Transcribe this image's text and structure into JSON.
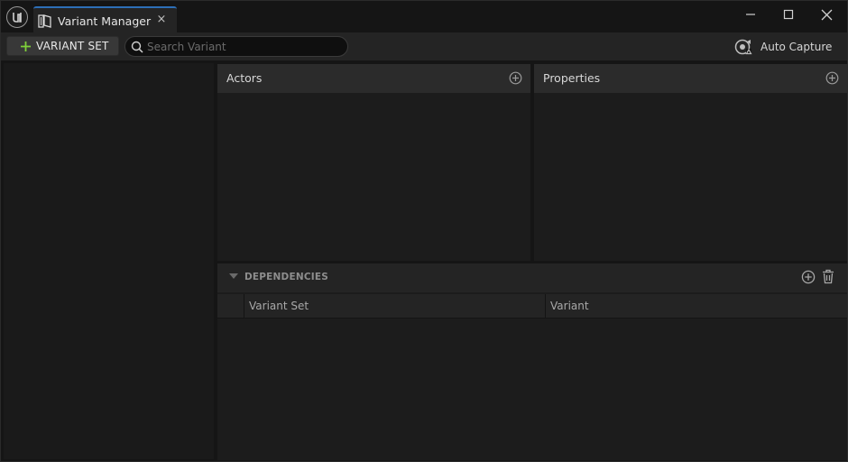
{
  "window": {
    "tab_title": "Variant Manager",
    "tab_close": "×"
  },
  "toolbar": {
    "add_variant_set_label": "VARIANT SET",
    "search_placeholder": "Search Variant",
    "search_value": "",
    "auto_capture_label": "Auto Capture"
  },
  "panels": {
    "actors_title": "Actors",
    "properties_title": "Properties"
  },
  "dependencies": {
    "title": "DEPENDENCIES",
    "columns": [
      "Variant Set",
      "Variant"
    ]
  },
  "colors": {
    "accent_green": "#7fcf3a",
    "tab_accent_blue": "#2d6fb8"
  }
}
